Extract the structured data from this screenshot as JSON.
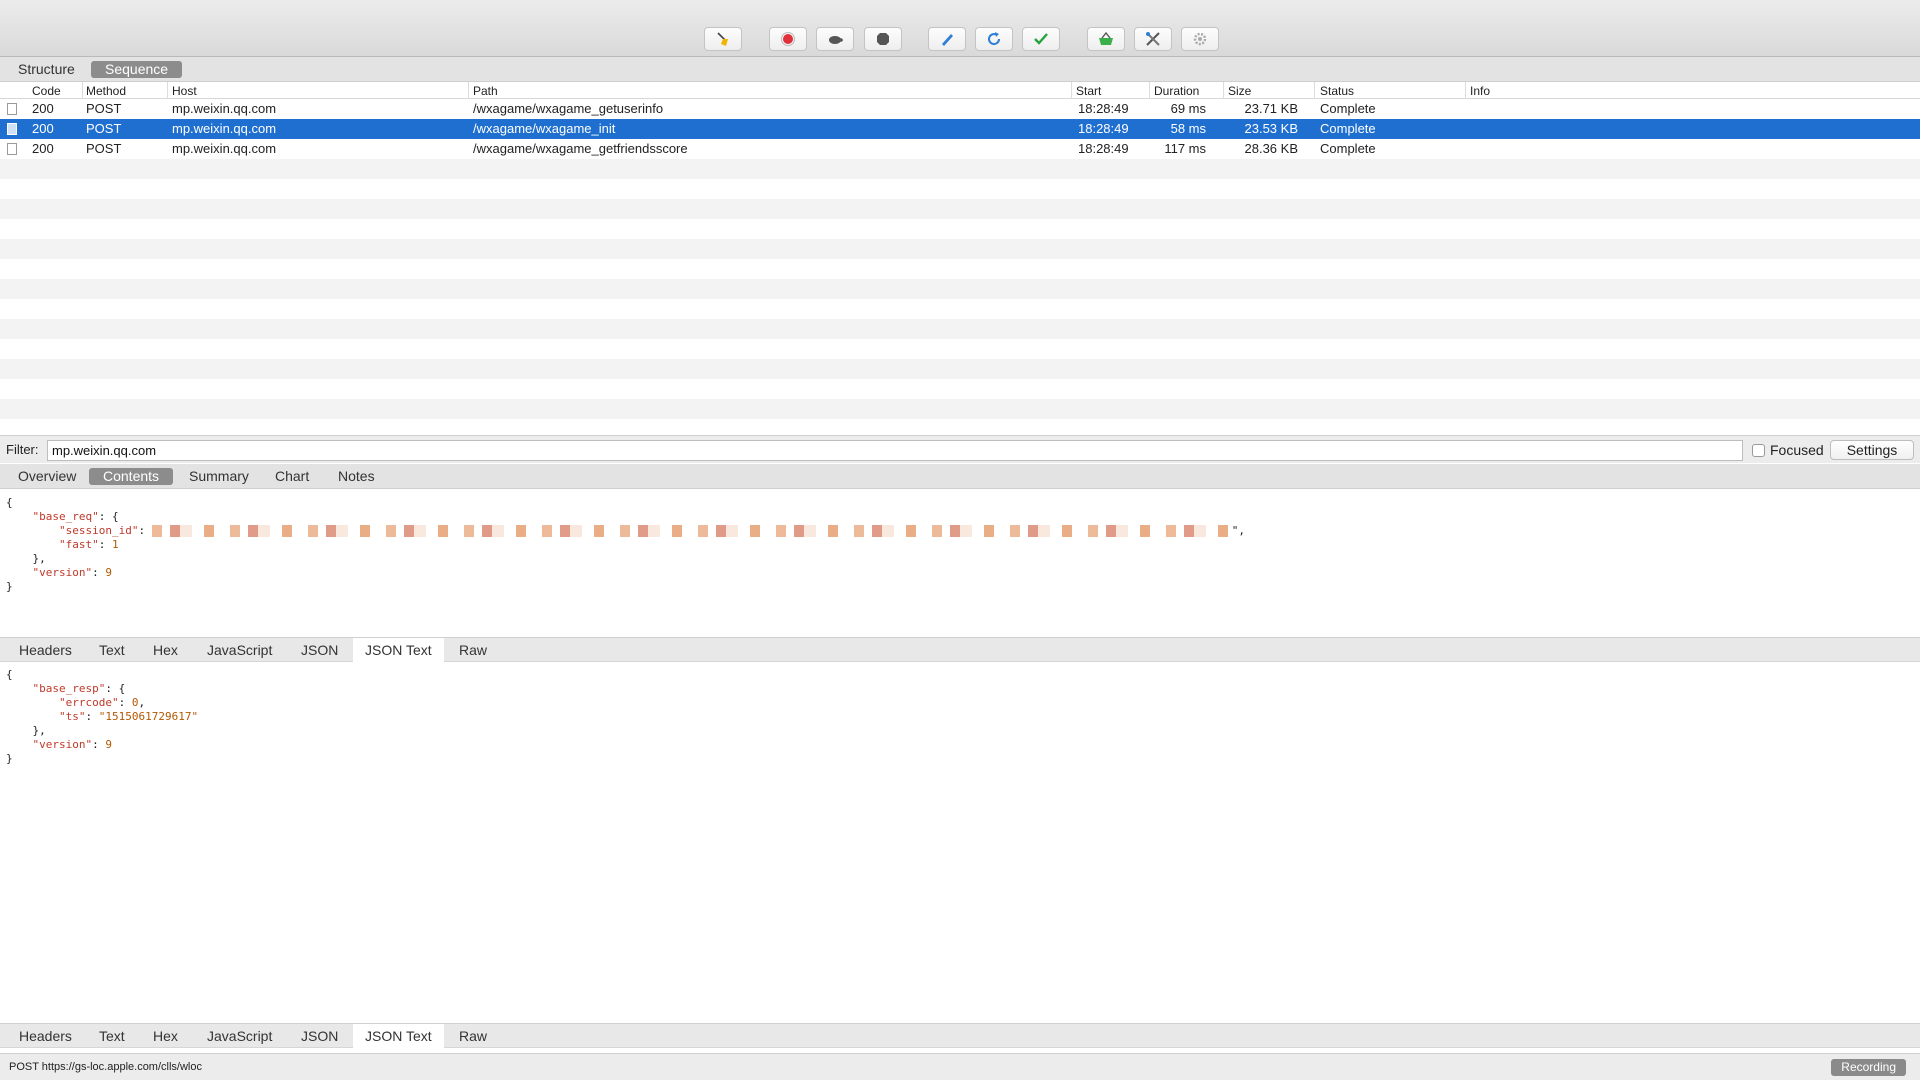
{
  "toolbar": {
    "buttons": [
      {
        "name": "broom-icon"
      },
      {
        "name": "record-icon",
        "color": "#e0303a"
      },
      {
        "name": "turtle-icon"
      },
      {
        "name": "stop-icon"
      },
      {
        "name": "pen-icon",
        "color": "#2e7fd6"
      },
      {
        "name": "refresh-icon",
        "color": "#2e7fd6"
      },
      {
        "name": "checkmark-icon",
        "color": "#27a33e"
      },
      {
        "name": "basket-icon",
        "color": "#3bb04a"
      },
      {
        "name": "tools-icon"
      },
      {
        "name": "gear-icon"
      }
    ]
  },
  "view_tabs": [
    "Structure",
    "Sequence"
  ],
  "table": {
    "columns": [
      "Code",
      "Method",
      "Host",
      "Path",
      "Start",
      "Duration",
      "Size",
      "Status",
      "Info"
    ],
    "rows": [
      {
        "code": "200",
        "method": "POST",
        "host": "mp.weixin.qq.com",
        "path": "/wxagame/wxagame_getuserinfo",
        "start": "18:28:49",
        "duration": "69 ms",
        "size": "23.71 KB",
        "status": "Complete",
        "info": ""
      },
      {
        "code": "200",
        "method": "POST",
        "host": "mp.weixin.qq.com",
        "path": "/wxagame/wxagame_init",
        "start": "18:28:49",
        "duration": "58 ms",
        "size": "23.53 KB",
        "status": "Complete",
        "info": ""
      },
      {
        "code": "200",
        "method": "POST",
        "host": "mp.weixin.qq.com",
        "path": "/wxagame/wxagame_getfriendsscore",
        "start": "18:28:49",
        "duration": "117 ms",
        "size": "28.36 KB",
        "status": "Complete",
        "info": ""
      }
    ],
    "selected_index": 1
  },
  "filter": {
    "label": "Filter:",
    "value": "mp.weixin.qq.com",
    "focused_label": "Focused",
    "settings_label": "Settings"
  },
  "detail_tabs": [
    "Overview",
    "Contents",
    "Summary",
    "Chart",
    "Notes"
  ],
  "request_body": {
    "open": "{",
    "base_req_key": "\"base_req\"",
    "session_id_key": "\"session_id\"",
    "fast_key": "\"fast\"",
    "fast_value": "1",
    "version_key": "\"version\"",
    "version_value": "9",
    "close": "}"
  },
  "format_tabs": [
    "Headers",
    "Text",
    "Hex",
    "JavaScript",
    "JSON",
    "JSON Text",
    "Raw"
  ],
  "response_body": {
    "base_resp_key": "\"base_resp\"",
    "errcode_key": "\"errcode\"",
    "errcode_value": "0",
    "ts_key": "\"ts\"",
    "ts_value": "\"1515061729617\"",
    "version_key": "\"version\"",
    "version_value": "9"
  },
  "status_bar": {
    "text": "POST https://gs-loc.apple.com/clls/wloc",
    "recording": "Recording"
  }
}
